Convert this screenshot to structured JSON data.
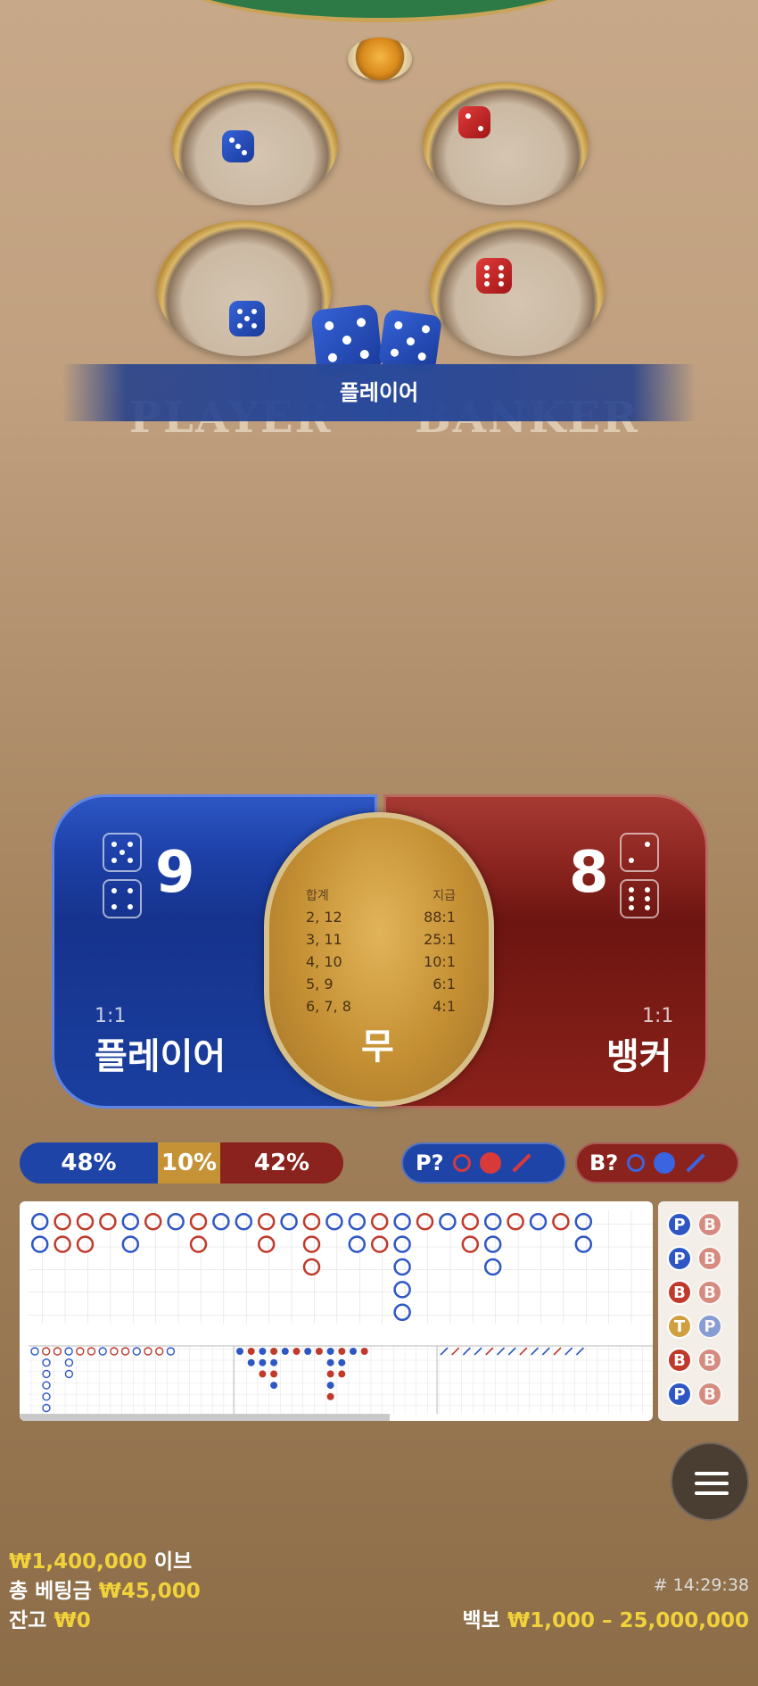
{
  "table": {
    "result_banner": "플레이어",
    "player_label": "PLAYER",
    "banker_label": "BANKER"
  },
  "bet": {
    "player": {
      "score": "9",
      "odds": "1:1",
      "label": "플레이어"
    },
    "banker": {
      "score": "8",
      "odds": "1:1",
      "label": "뱅커"
    },
    "tie": {
      "label": "무",
      "header_sum": "합계",
      "header_pay": "지급",
      "rows": [
        {
          "sum": "2, 12",
          "pay": "88:1"
        },
        {
          "sum": "3, 11",
          "pay": "25:1"
        },
        {
          "sum": "4, 10",
          "pay": "10:1"
        },
        {
          "sum": "5, 9",
          "pay": "6:1"
        },
        {
          "sum": "6, 7, 8",
          "pay": "4:1"
        }
      ]
    }
  },
  "stats": {
    "player_pct": "48%",
    "tie_pct": "10%",
    "banker_pct": "42%"
  },
  "predict": {
    "player_label": "P?",
    "banker_label": "B?"
  },
  "bead_road": [
    "P",
    "B",
    "P",
    "B",
    "B",
    "B",
    "T",
    "P",
    "B",
    "B",
    "P",
    "B"
  ],
  "footer": {
    "limit_amount": "₩1,400,000",
    "limit_suffix": "이브",
    "total_bet_label": "총 베팅금",
    "total_bet_value": "₩45,000",
    "balance_label": "잔고",
    "balance_value": "₩0",
    "game_id": "# 14:29:38",
    "table_limit_label": "백보",
    "table_limit_value": "₩1,000 – 25,000,000"
  },
  "colors": {
    "player": "#1c3fa6",
    "banker": "#8e2621",
    "tie": "#c48f33",
    "accent_gold": "#f2d23a"
  }
}
